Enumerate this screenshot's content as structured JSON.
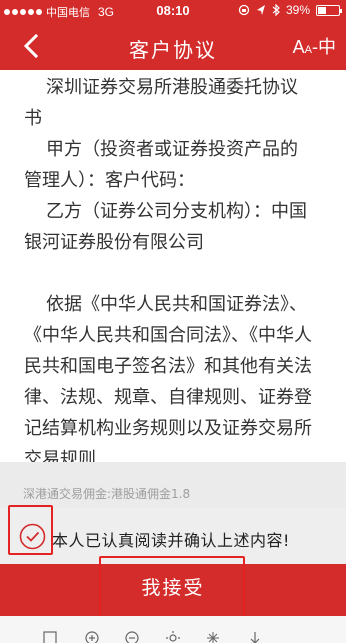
{
  "status_bar": {
    "carrier": "中国电信",
    "network": "3G",
    "time": "08:10",
    "battery": "39%",
    "battery_level": 0.39
  },
  "nav": {
    "title": "客户协议",
    "font_size_label_big": "A",
    "font_size_label_small": "A",
    "font_size_suffix": "-中"
  },
  "document": {
    "title": "深圳证券交易所港股通委托协议书",
    "party_a": "甲方（投资者或证券投资产品的管理人）：客户代码：",
    "party_b": "乙方（证券公司分支机构）：中国银河证券股份有限公司",
    "body": "依据《中华人民共和国证券法》、《中华人民共和国合同法》、《中华人民共和国电子签名法》和其他有关法律、法规、规章、自律规则、证券登记结算机构业务规则以及证券交易所交易规则"
  },
  "commission": {
    "text": "深港通交易佣金:港股通佣金1.8"
  },
  "confirm": {
    "text": "本人已认真阅读并确认上述内容!",
    "checked": true
  },
  "accept_button": {
    "label": "我接受"
  },
  "colors": {
    "brand_red": "#d42b2b",
    "highlight_red": "#e52222"
  },
  "toolbar_icons": [
    "square-icon",
    "zoom-in-icon",
    "zoom-out-icon",
    "sun-icon",
    "brightness-icon",
    "down-arrow-icon"
  ]
}
